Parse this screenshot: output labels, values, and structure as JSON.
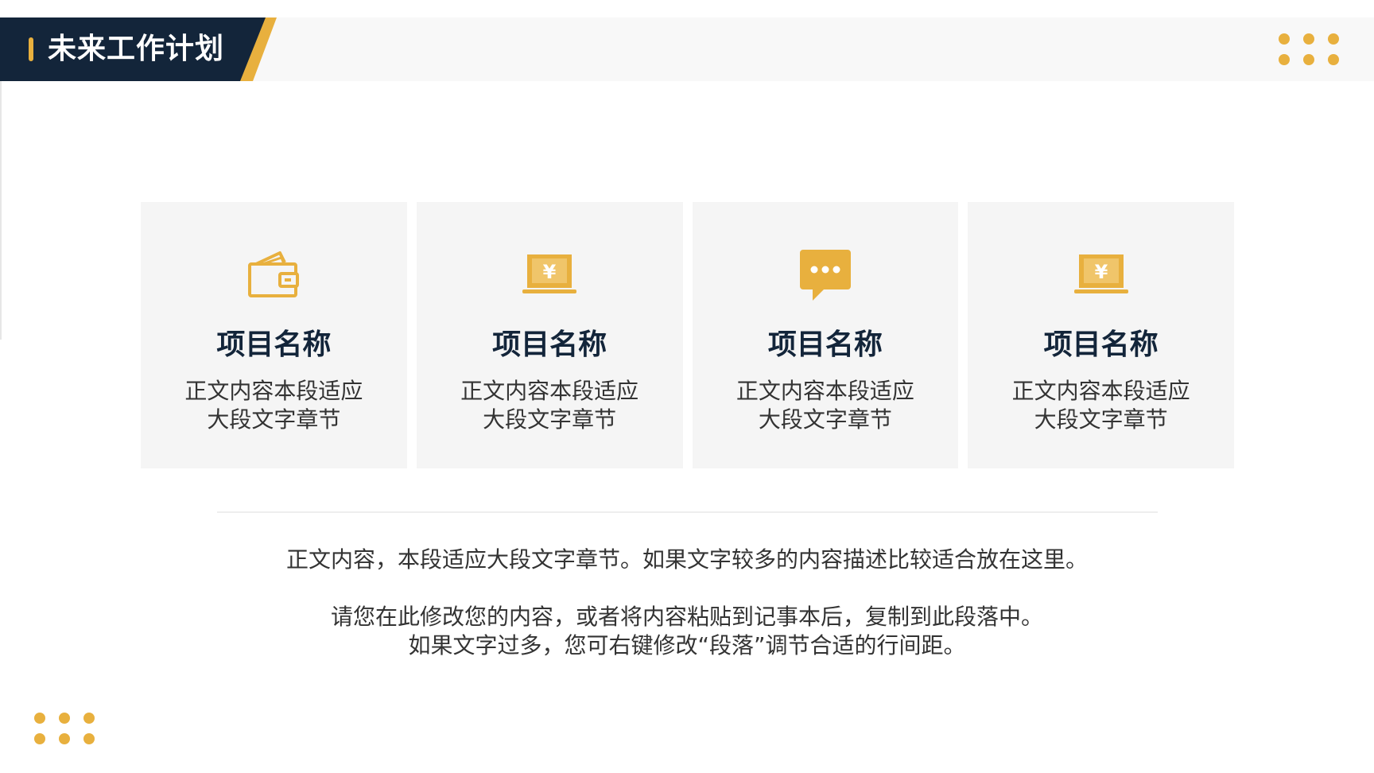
{
  "header": {
    "title": "未来工作计划"
  },
  "colors": {
    "accent": "#e8b03e",
    "dark": "#13253a",
    "card_bg": "#f5f5f5"
  },
  "cards": [
    {
      "icon": "wallet-icon",
      "title": "项目名称",
      "body_line1": "正文内容本段适应",
      "body_line2": "大段文字章节"
    },
    {
      "icon": "laptop-yen-icon",
      "title": "项目名称",
      "body_line1": "正文内容本段适应",
      "body_line2": "大段文字章节"
    },
    {
      "icon": "chat-bubble-icon",
      "title": "项目名称",
      "body_line1": "正文内容本段适应",
      "body_line2": "大段文字章节"
    },
    {
      "icon": "laptop-yen-icon",
      "title": "项目名称",
      "body_line1": "正文内容本段适应",
      "body_line2": "大段文字章节"
    }
  ],
  "paragraphs": {
    "line1": "正文内容，本段适应大段文字章节。如果文字较多的内容描述比较适合放在这里。",
    "line2": "请您在此修改您的内容，或者将内容粘贴到记事本后，复制到此段落中。",
    "line3": "如果文字过多，您可右键修改“段落”调节合适的行间距。"
  }
}
